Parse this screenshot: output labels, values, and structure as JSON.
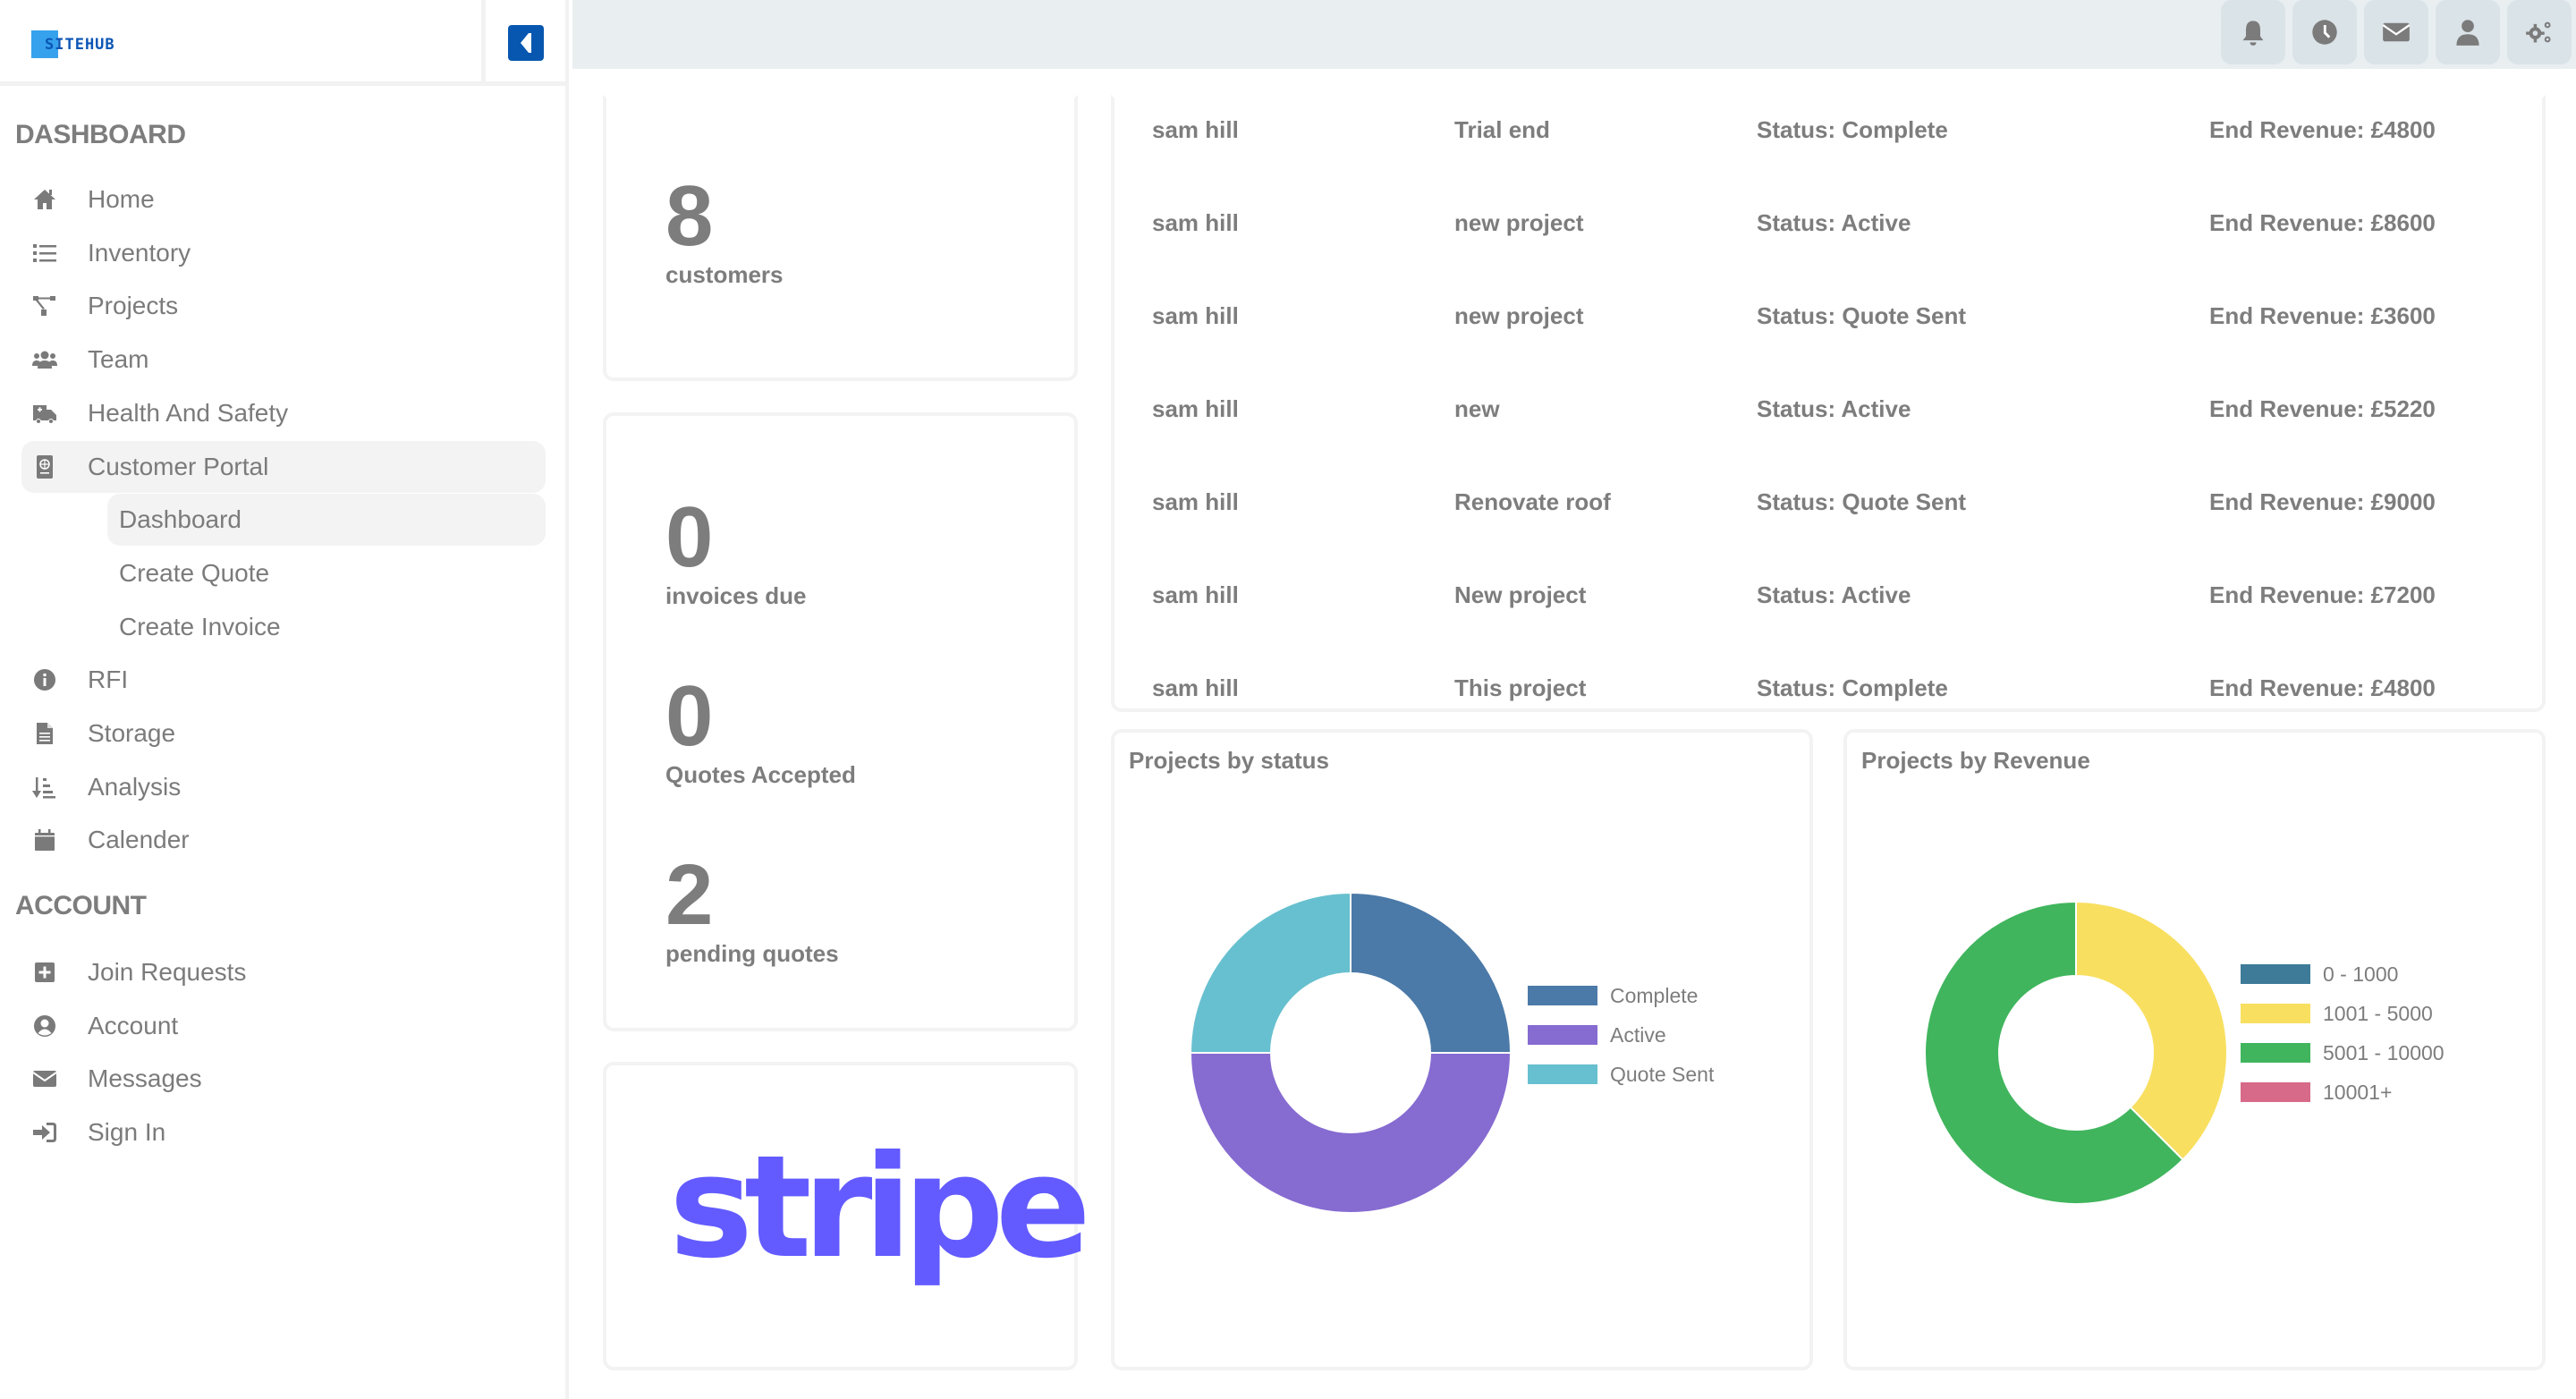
{
  "brand": {
    "name": "SITEHUB"
  },
  "sidebar": {
    "sections": [
      {
        "title": "DASHBOARD"
      },
      {
        "title": "ACCOUNT"
      }
    ],
    "dashboard_items": [
      {
        "label": "Home",
        "icon": "home-icon"
      },
      {
        "label": "Inventory",
        "icon": "list-icon"
      },
      {
        "label": "Projects",
        "icon": "sitemap-icon"
      },
      {
        "label": "Team",
        "icon": "users-icon"
      },
      {
        "label": "Health And Safety",
        "icon": "ambulance-icon"
      },
      {
        "label": "Customer Portal",
        "icon": "passport-icon",
        "active": true
      }
    ],
    "sub_items": [
      {
        "label": "Dashboard",
        "active": true
      },
      {
        "label": "Create Quote"
      },
      {
        "label": "Create Invoice"
      }
    ],
    "more_items": [
      {
        "label": "RFI",
        "icon": "info-circle-icon"
      },
      {
        "label": "Storage",
        "icon": "file-icon"
      },
      {
        "label": "Analysis",
        "icon": "sort-amount-icon"
      },
      {
        "label": "Calender",
        "icon": "calendar-icon"
      }
    ],
    "account_items": [
      {
        "label": "Join Requests",
        "icon": "plus-square-icon"
      },
      {
        "label": "Account",
        "icon": "user-circle-icon"
      },
      {
        "label": "Messages",
        "icon": "envelope-icon"
      },
      {
        "label": "Sign In",
        "icon": "sign-in-icon"
      }
    ]
  },
  "topbar": {
    "buttons": [
      "bell-icon",
      "clock-icon",
      "envelope-icon",
      "user-icon",
      "cogs-icon"
    ]
  },
  "stats": {
    "customers": {
      "value": "8",
      "label": "customers"
    },
    "invoices_due": {
      "value": "0",
      "label": "invoices due"
    },
    "quotes_accepted": {
      "value": "0",
      "label": "Quotes Accepted"
    },
    "pending_quotes": {
      "value": "2",
      "label": "pending quotes"
    }
  },
  "payment": {
    "provider": "stripe",
    "color": "#635bff"
  },
  "projects": [
    {
      "customer": "sam hill",
      "name": "Trial end",
      "status": "Status: Complete",
      "revenue": "End Revenue: £4800"
    },
    {
      "customer": "sam hill",
      "name": "new project",
      "status": "Status: Active",
      "revenue": "End Revenue: £8600"
    },
    {
      "customer": "sam hill",
      "name": "new project",
      "status": "Status: Quote Sent",
      "revenue": "End Revenue: £3600"
    },
    {
      "customer": "sam hill",
      "name": "new",
      "status": "Status: Active",
      "revenue": "End Revenue: £5220"
    },
    {
      "customer": "sam hill",
      "name": "Renovate roof",
      "status": "Status: Quote Sent",
      "revenue": "End Revenue: £9000"
    },
    {
      "customer": "sam hill",
      "name": "New project",
      "status": "Status: Active",
      "revenue": "End Revenue: £7200"
    },
    {
      "customer": "sam hill",
      "name": "This project",
      "status": "Status: Complete",
      "revenue": "End Revenue: £4800"
    }
  ],
  "chart_data": [
    {
      "type": "pie",
      "variant": "doughnut",
      "title": "Projects by status",
      "categories": [
        "Complete",
        "Active",
        "Quote Sent"
      ],
      "values": [
        2,
        4,
        2
      ],
      "colors": [
        "#4b7aa8",
        "#866bd1",
        "#67c0cf"
      ],
      "legend": "right"
    },
    {
      "type": "pie",
      "variant": "doughnut",
      "title": "Projects by Revenue",
      "categories": [
        "0 - 1000",
        "1001 - 5000",
        "5001 - 10000",
        "10001+"
      ],
      "values": [
        0,
        3,
        5,
        0
      ],
      "colors": [
        "#3e7b98",
        "#f8df60",
        "#40b55d",
        "#d76a88"
      ],
      "legend": "right"
    }
  ]
}
